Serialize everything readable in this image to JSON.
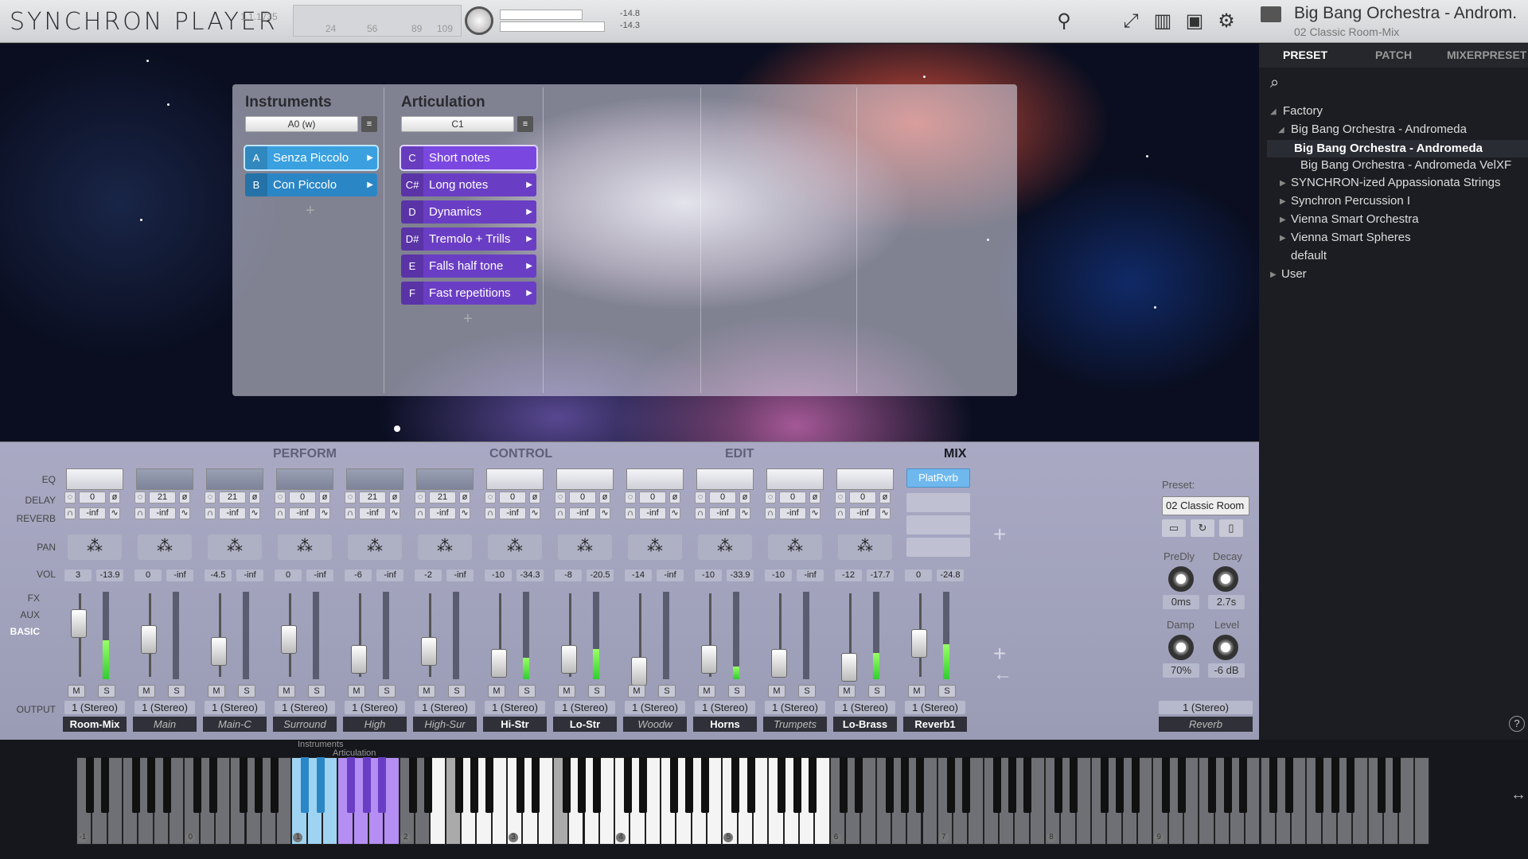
{
  "app": {
    "name": "SYNCHRON PLAYER",
    "version": "1.1.1735"
  },
  "topbar": {
    "cpu_ticks": [
      "24",
      "56",
      "89",
      "109"
    ],
    "meter_levels": [
      "-14.8",
      "-14.3"
    ],
    "preset_title": "Big Bang Orchestra - Androm.",
    "preset_subtitle": "02 Classic Room-Mix"
  },
  "instruments": {
    "title": "Instruments",
    "selector": "A0 (w)",
    "slots": [
      {
        "key": "A",
        "label": "Senza Piccolo"
      },
      {
        "key": "B",
        "label": "Con Piccolo"
      }
    ]
  },
  "articulation": {
    "title": "Articulation",
    "selector": "C1",
    "slots": [
      {
        "key": "C",
        "label": "Short notes"
      },
      {
        "key": "C#",
        "label": "Long notes"
      },
      {
        "key": "D",
        "label": "Dynamics"
      },
      {
        "key": "D#",
        "label": "Tremolo + Trills"
      },
      {
        "key": "E",
        "label": "Falls half tone"
      },
      {
        "key": "F",
        "label": "Fast repetitions"
      }
    ]
  },
  "browser": {
    "tabs": [
      "PRESET",
      "PATCH",
      "MIXERPRESET"
    ],
    "tree": [
      {
        "label": "Factory"
      },
      {
        "label": "Big Bang Orchestra - Andromeda"
      },
      {
        "label": "Big Bang Orchestra - Andromeda"
      },
      {
        "label": "Big Bang Orchestra - Andromeda VelXF"
      },
      {
        "label": "SYNCHRON-ized Appassionata Strings"
      },
      {
        "label": "Synchron Percussion I"
      },
      {
        "label": "Vienna Smart Orchestra"
      },
      {
        "label": "Vienna Smart Spheres"
      },
      {
        "label": "default"
      },
      {
        "label": "User"
      }
    ]
  },
  "mixer": {
    "modes": [
      "PERFORM",
      "CONTROL",
      "EDIT",
      "MIX"
    ],
    "row_labels": [
      "EQ",
      "DELAY",
      "REVERB",
      "PAN",
      "VOL",
      "FX",
      "AUX",
      "BASIC",
      "OUTPUT"
    ],
    "output": "1 (Stereo)",
    "channels": [
      {
        "name": "Room-Mix",
        "delay": "0",
        "reverb": "-inf",
        "vol": "3",
        "peak": "-13.9"
      },
      {
        "name": "Main",
        "delay": "21",
        "reverb": "-inf",
        "vol": "0",
        "peak": "-inf"
      },
      {
        "name": "Main-C",
        "delay": "21",
        "reverb": "-inf",
        "vol": "-4.5",
        "peak": "-inf"
      },
      {
        "name": "Surround",
        "delay": "0",
        "reverb": "-inf",
        "vol": "0",
        "peak": "-inf"
      },
      {
        "name": "High",
        "delay": "21",
        "reverb": "-inf",
        "vol": "-6",
        "peak": "-inf"
      },
      {
        "name": "High-Sur",
        "delay": "21",
        "reverb": "-inf",
        "vol": "-2",
        "peak": "-inf"
      },
      {
        "name": "Hi-Str",
        "delay": "0",
        "reverb": "-inf",
        "vol": "-10",
        "peak": "-34.3"
      },
      {
        "name": "Lo-Str",
        "delay": "0",
        "reverb": "-inf",
        "vol": "-8",
        "peak": "-20.5"
      },
      {
        "name": "Woodw",
        "delay": "0",
        "reverb": "-inf",
        "vol": "-14",
        "peak": "-inf"
      },
      {
        "name": "Horns",
        "delay": "0",
        "reverb": "-inf",
        "vol": "-10",
        "peak": "-33.9"
      },
      {
        "name": "Trumpets",
        "delay": "0",
        "reverb": "-inf",
        "vol": "-10",
        "peak": "-inf"
      },
      {
        "name": "Lo-Brass",
        "delay": "0",
        "reverb": "-inf",
        "vol": "-12",
        "peak": "-17.7"
      },
      {
        "name": "Reverb1",
        "delay": "",
        "reverb": "",
        "vol": "0",
        "peak": "-24.8",
        "insert": "PlatRvrb"
      }
    ],
    "mute": "M",
    "solo": "S"
  },
  "reverb": {
    "preset_label": "Preset:",
    "preset": "02 Classic Room",
    "knobs": [
      {
        "label": "PreDly",
        "value": "0ms"
      },
      {
        "label": "Decay",
        "value": "2.7s"
      },
      {
        "label": "Damp",
        "value": "70%"
      },
      {
        "label": "Level",
        "value": "-6 dB"
      }
    ],
    "output": "1 (Stereo)",
    "name": "Reverb"
  },
  "keyboard": {
    "labels": [
      "Instruments",
      "Articulation"
    ],
    "octaves": [
      "-1",
      "0",
      "1",
      "2",
      "3",
      "4",
      "5",
      "6",
      "7",
      "8",
      "9"
    ]
  }
}
